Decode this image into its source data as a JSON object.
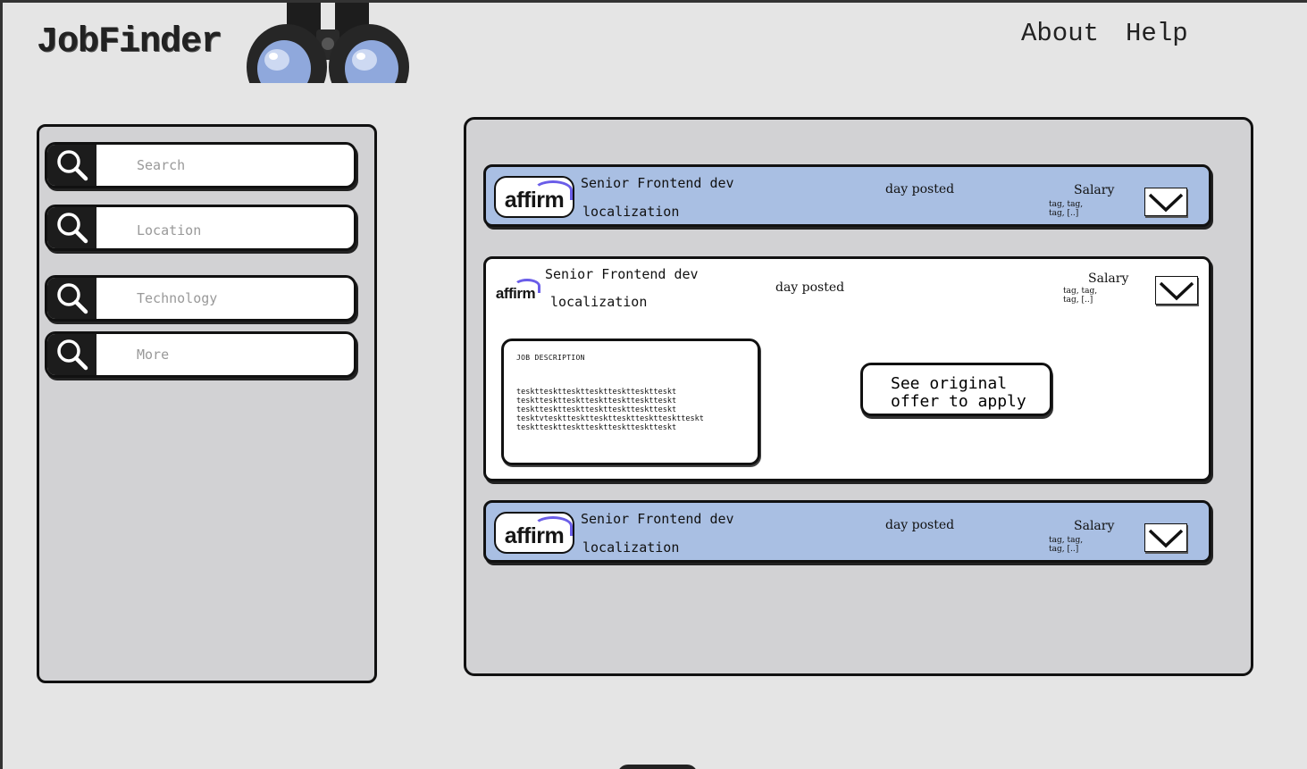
{
  "header": {
    "app_name": "JobFinder",
    "nav": [
      {
        "label": "About"
      },
      {
        "label": "Help"
      }
    ]
  },
  "sidebar": {
    "filters": [
      {
        "placeholder": "Search",
        "icon": "search-icon"
      },
      {
        "placeholder": "Location",
        "icon": "search-icon"
      },
      {
        "placeholder": "Technology",
        "icon": "search-icon"
      },
      {
        "placeholder": "More",
        "icon": "search-icon"
      }
    ]
  },
  "jobs": [
    {
      "company": "affirm",
      "title": "Senior Frontend dev",
      "location": "localization",
      "day": "day posted",
      "salary": "Salary",
      "tags": "tag, tag, tag, [..]",
      "expanded": false
    },
    {
      "company": "affirm",
      "title": "Senior Frontend dev",
      "location": "localization",
      "day": "day posted",
      "salary": "Salary",
      "tags": "tag, tag, tag, [..]",
      "expanded": true,
      "description_title": "JOB DESCRIPTION",
      "description_text": "teskttesktteskttesktteskttesktteskt\nteskttesktteskttesktteskttesktteskt\nteskttesktteskttesktteskttesktteskt\ntesktvteskttesktteskttesktteskttesktteskt\nteskttesktteskttesktteskttesktteskt",
      "apply_label": "See original offer to apply"
    },
    {
      "company": "affirm",
      "title": "Senior Frontend dev",
      "location": "localization",
      "day": "day posted",
      "salary": "Salary",
      "tags": "tag, tag, tag, [..]",
      "expanded": false
    }
  ],
  "colors": {
    "background": "#e5e5e5",
    "panel": "#d2d2d4",
    "card_collapsed": "#a9bfe3",
    "brand_arc": "#6a5de8"
  }
}
